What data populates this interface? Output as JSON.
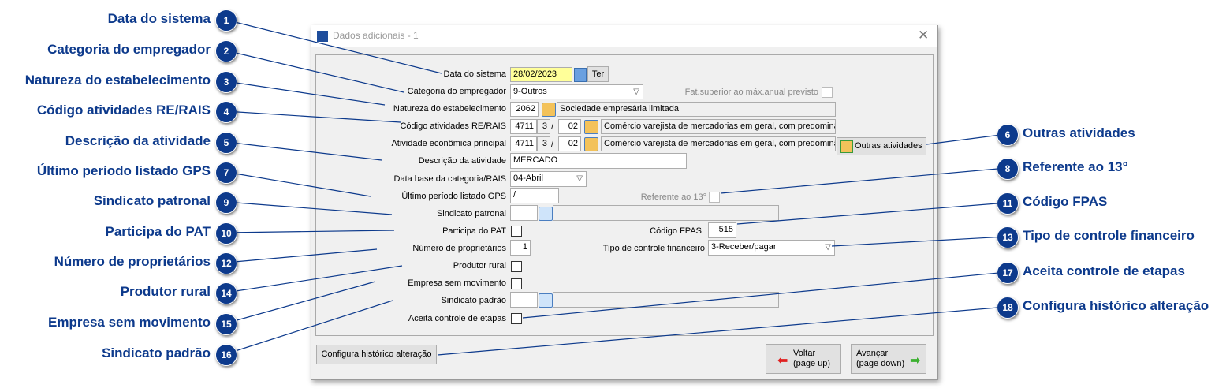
{
  "window": {
    "title": "Dados adicionais - 1",
    "close": "✕"
  },
  "form": {
    "data_sistema": {
      "label": "Data do sistema",
      "value": "28/02/2023",
      "day": "Ter"
    },
    "categoria": {
      "label": "Categoria do empregador",
      "value": "9-Outros"
    },
    "fat_superior": {
      "label": "Fat.superior ao máx.anual previsto",
      "checked": false
    },
    "natureza": {
      "label": "Natureza do estabelecimento",
      "code": "2062",
      "desc": "Sociedade empresária limitada"
    },
    "codigo_atividades": {
      "label": "Código atividades RE/RAIS",
      "code": "4711",
      "digit": "3",
      "sep": "/",
      "sub": "02",
      "desc": "Comércio varejista de mercadorias em geral, com predominân"
    },
    "atividade_principal": {
      "label": "Atividade econômica principal",
      "code": "4711",
      "digit": "3",
      "sep": "/",
      "sub": "02",
      "desc": "Comércio varejista de mercadorias em geral, com predominân"
    },
    "outras_atividades": "Outras atividades",
    "descricao": {
      "label": "Descrição da atividade",
      "value": "MERCADO"
    },
    "data_base": {
      "label": "Data base da categoria/RAIS",
      "value": "04-Abril"
    },
    "ultimo_periodo": {
      "label": "Último período listado GPS",
      "value": "/"
    },
    "referente13": {
      "label": "Referente ao 13°",
      "checked": false
    },
    "sindicato_patronal": {
      "label": "Sindicato patronal",
      "value": ""
    },
    "pat": {
      "label": "Participa do PAT",
      "checked": false
    },
    "fpas": {
      "label": "Código FPAS",
      "value": "515"
    },
    "proprietarios": {
      "label": "Número de proprietários",
      "value": "1"
    },
    "tipo_controle": {
      "label": "Tipo de controle financeiro",
      "value": "3-Receber/pagar"
    },
    "produtor_rural": {
      "label": "Produtor rural",
      "checked": false
    },
    "sem_movimento": {
      "label": "Empresa sem movimento",
      "checked": false
    },
    "sindicato_padrao": {
      "label": "Sindicato padrão",
      "value": ""
    },
    "etapas": {
      "label": "Aceita controle de etapas",
      "checked": false
    }
  },
  "footer": {
    "configura": "Configura histórico alteração",
    "voltar": "Voltar",
    "voltar_sub": "(page up)",
    "avancar": "Avançar",
    "avancar_sub": "(page down)"
  },
  "callouts": [
    {
      "n": "1",
      "text": "Data do sistema"
    },
    {
      "n": "2",
      "text": "Categoria do empregador"
    },
    {
      "n": "3",
      "text": "Natureza do estabelecimento"
    },
    {
      "n": "4",
      "text": "Código atividades RE/RAIS"
    },
    {
      "n": "5",
      "text": "Descrição da atividade"
    },
    {
      "n": "6",
      "text": "Outras atividades"
    },
    {
      "n": "7",
      "text": "Último período listado GPS"
    },
    {
      "n": "8",
      "text": "Referente ao 13°"
    },
    {
      "n": "9",
      "text": "Sindicato patronal"
    },
    {
      "n": "10",
      "text": "Participa do PAT"
    },
    {
      "n": "11",
      "text": "Código FPAS"
    },
    {
      "n": "12",
      "text": "Número de proprietários"
    },
    {
      "n": "13",
      "text": "Tipo de controle financeiro"
    },
    {
      "n": "14",
      "text": "Produtor rural"
    },
    {
      "n": "15",
      "text": "Empresa sem movimento"
    },
    {
      "n": "16",
      "text": "Sindicato padrão"
    },
    {
      "n": "17",
      "text": "Aceita controle de etapas"
    },
    {
      "n": "18",
      "text": "Configura histórico alteração"
    }
  ],
  "colors": {
    "callout": "#0d3a8c",
    "date_bg": "#ffff99"
  }
}
